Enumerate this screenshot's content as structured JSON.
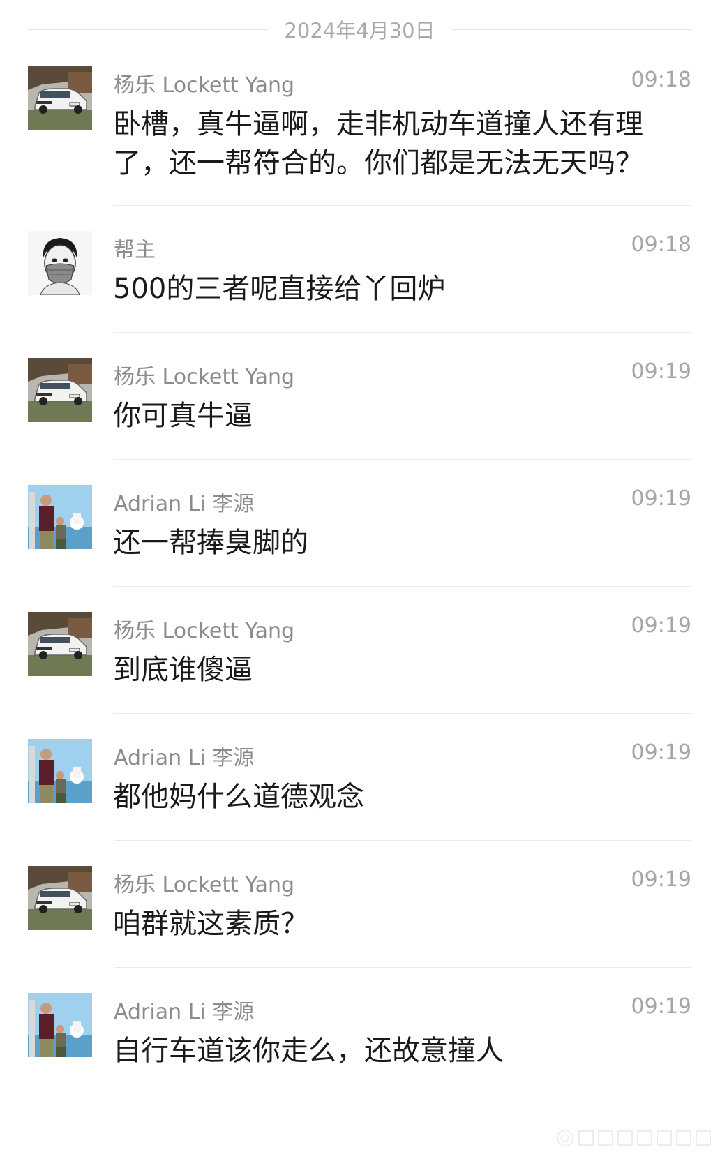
{
  "date_divider": "2024年4月30日",
  "messages": [
    {
      "sender": "杨乐 Lockett Yang",
      "time": "09:18",
      "text": "卧槽，真牛逼啊，走非机动车道撞人还有理了，还一帮符合的。你们都是无法无天吗？",
      "avatar": "car-avatar"
    },
    {
      "sender": "帮主",
      "time": "09:18",
      "text": "500的三者呢直接给丫回炉",
      "avatar": "masked-man-avatar"
    },
    {
      "sender": "杨乐 Lockett Yang",
      "time": "09:19",
      "text": "你可真牛逼",
      "avatar": "car-avatar"
    },
    {
      "sender": "Adrian Li 李源",
      "time": "09:19",
      "text": "还一帮捧臭脚的",
      "avatar": "father-son-photo-avatar"
    },
    {
      "sender": "杨乐 Lockett Yang",
      "time": "09:19",
      "text": "到底谁傻逼",
      "avatar": "car-avatar"
    },
    {
      "sender": "Adrian Li 李源",
      "time": "09:19",
      "text": "都他妈什么道德观念",
      "avatar": "father-son-photo-avatar"
    },
    {
      "sender": "杨乐 Lockett Yang",
      "time": "09:19",
      "text": "咱群就这素质？",
      "avatar": "car-avatar"
    },
    {
      "sender": "Adrian Li 李源",
      "time": "09:19",
      "text": "自行车道该你走么，还故意撞人",
      "avatar": "father-son-photo-avatar"
    }
  ]
}
